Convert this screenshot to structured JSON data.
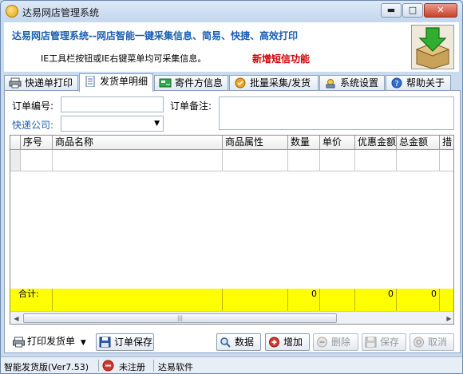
{
  "window": {
    "title": "达易网店管理系统",
    "minimize": "▬",
    "maximize": "□",
    "close": "✕"
  },
  "header": {
    "title": "达易网店管理系统--网店智能一键采集信息、简易、快捷、高效打印",
    "subtitle": "IE工具栏按钮或IE右键菜单均可采集信息。",
    "new_feature": "新增短信功能"
  },
  "tabs": [
    {
      "label": "快递单打印",
      "icon": "printer-icon"
    },
    {
      "label": "发货单明细",
      "icon": "document-icon"
    },
    {
      "label": "寄件方信息",
      "icon": "sender-card-icon"
    },
    {
      "label": "批量采集/发货",
      "icon": "batch-collect-icon"
    },
    {
      "label": "系统设置",
      "icon": "settings-icon"
    },
    {
      "label": "帮助关于",
      "icon": "help-icon"
    }
  ],
  "form": {
    "order_no_label": "订单编号:",
    "order_no_value": "",
    "remark_label": "订单备注:",
    "remark_value": "",
    "courier_label": "快递公司:",
    "courier_value": ""
  },
  "grid": {
    "columns": [
      "序号",
      "商品名称",
      "商品属性",
      "数量",
      "单价",
      "优惠金额",
      "总金额",
      "措"
    ],
    "total_label": "合计:",
    "totals": {
      "quantity": "0",
      "discount": "0",
      "total": "0"
    }
  },
  "toolbar": {
    "print_invoice": "打印发货单",
    "save_order": "订单保存",
    "data": "数据",
    "add": "增加",
    "delete": "删除",
    "save": "保存",
    "cancel": "取消"
  },
  "status": {
    "version": "智能发货版(Ver7.53)",
    "registration": "未注册",
    "company": "达易软件"
  }
}
